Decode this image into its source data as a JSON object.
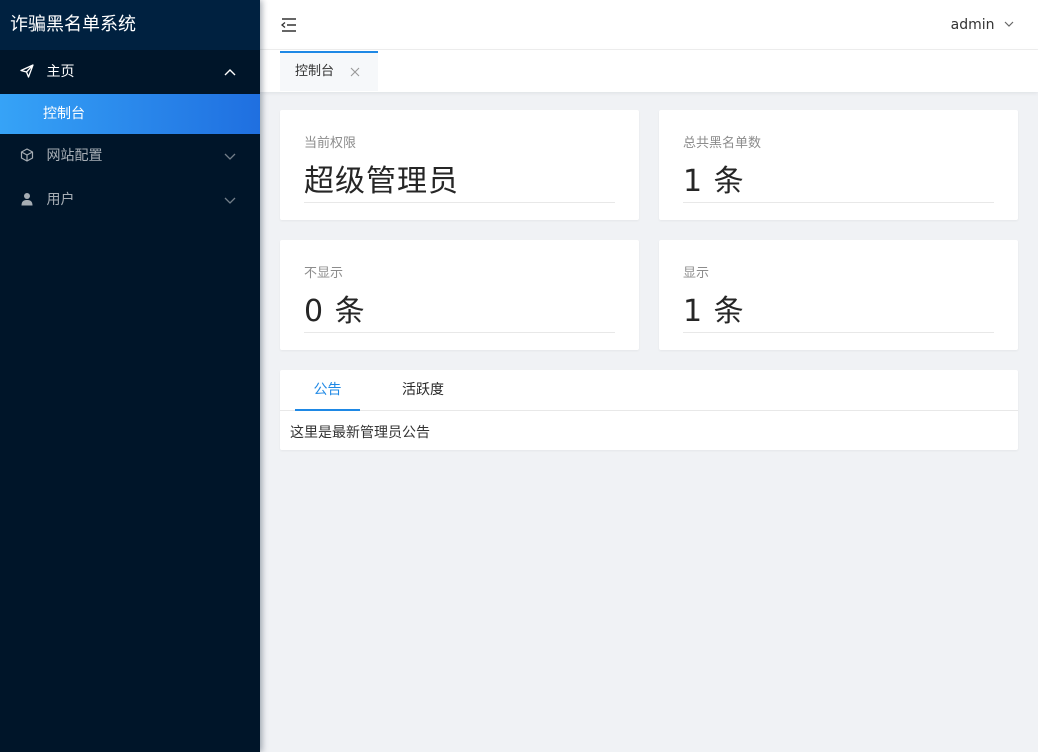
{
  "sidebar": {
    "brand": "诈骗黑名单系统",
    "items": [
      {
        "label": "主页",
        "icon": "send-icon",
        "expanded": true,
        "children": [
          {
            "label": "控制台",
            "active": true
          }
        ]
      },
      {
        "label": "网站配置",
        "icon": "cube-icon",
        "expanded": false
      },
      {
        "label": "用户",
        "icon": "user-icon",
        "expanded": false
      }
    ]
  },
  "header": {
    "fold_icon": "menu-fold-icon",
    "username": "admin"
  },
  "tabs": [
    {
      "label": "控制台",
      "active": true,
      "closable": true
    }
  ],
  "stats": [
    {
      "label": "当前权限",
      "value": "超级管理员"
    },
    {
      "label": "总共黑名单数",
      "value": "1 条"
    },
    {
      "label": "不显示",
      "value": "0 条"
    },
    {
      "label": "显示",
      "value": "1 条"
    }
  ],
  "notice": {
    "tabs": [
      "公告",
      "活跃度"
    ],
    "active_tab": "公告",
    "content": "这里是最新管理员公告"
  },
  "colors": {
    "sidebar_bg": "#001529",
    "accent": "#1e88e5",
    "page_bg": "#f0f2f5"
  }
}
